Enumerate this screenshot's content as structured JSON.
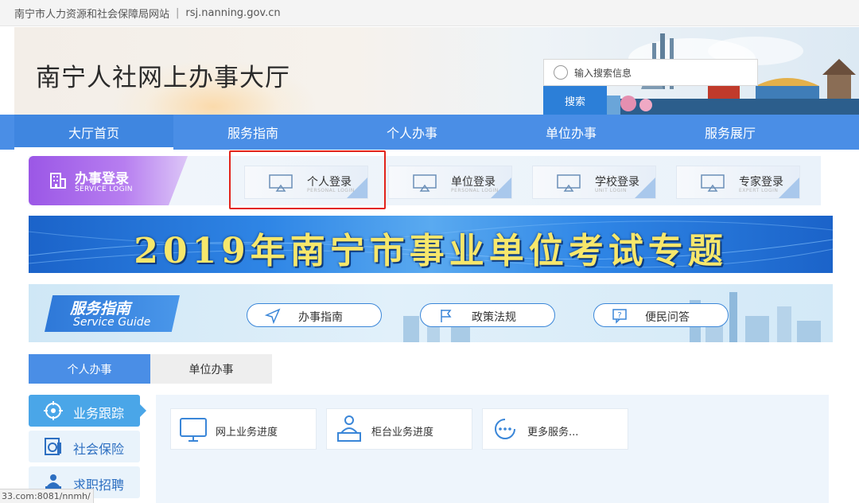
{
  "topbar": {
    "site_name": "南宁市人力资源和社会保障局网站",
    "separator": "|",
    "domain": "rsj.nanning.gov.cn"
  },
  "header": {
    "title": "南宁人社网上办事大厅"
  },
  "search": {
    "placeholder": "输入搜索信息",
    "button_label": "搜索"
  },
  "nav": {
    "items": [
      {
        "label": "大厅首页",
        "active": true
      },
      {
        "label": "服务指南",
        "active": false
      },
      {
        "label": "个人办事",
        "active": false
      },
      {
        "label": "单位办事",
        "active": false
      },
      {
        "label": "服务展厅",
        "active": false
      }
    ]
  },
  "login": {
    "badge_title": "办事登录",
    "badge_subtitle": "SERVICE LOGIN",
    "cards": [
      {
        "label": "个人登录",
        "sub": "PERSONAL LOGIN"
      },
      {
        "label": "单位登录",
        "sub": "PERSONAL LOGIN"
      },
      {
        "label": "学校登录",
        "sub": "UNIT LOGIN"
      },
      {
        "label": "专家登录",
        "sub": "EXPERT LOGIN"
      }
    ]
  },
  "exam_banner": {
    "title": "2019年南宁市事业单位考试专题"
  },
  "guide": {
    "title_cn": "服务指南",
    "title_en": "Service Guide",
    "links": [
      {
        "label": "办事指南",
        "icon": "send-arrow-icon"
      },
      {
        "label": "政策法规",
        "icon": "flag-icon"
      },
      {
        "label": "便民问答",
        "icon": "question-chat-icon"
      }
    ]
  },
  "tabs": [
    {
      "label": "个人办事",
      "active": true
    },
    {
      "label": "单位办事",
      "active": false
    }
  ],
  "sidebar": {
    "items": [
      {
        "label": "业务跟踪",
        "active": true,
        "icon": "target-icon"
      },
      {
        "label": "社会保险",
        "active": false,
        "icon": "insurance-card-icon"
      },
      {
        "label": "求职招聘",
        "active": false,
        "icon": "job-seeker-icon"
      }
    ]
  },
  "services": [
    {
      "label": "网上业务进度",
      "icon": "monitor-icon"
    },
    {
      "label": "柜台业务进度",
      "icon": "counter-clerk-icon"
    },
    {
      "label": "更多服务...",
      "icon": "more-dots-icon"
    }
  ],
  "statusbar": {
    "url": "33.com:8081/nnmh/"
  },
  "colors": {
    "nav_blue": "#4a8ee6",
    "highlight_red": "#e2231a",
    "login_purple": "#9b57e6",
    "exam_yellow": "#f7e76b",
    "sidebar_active": "#4aa6e8"
  }
}
